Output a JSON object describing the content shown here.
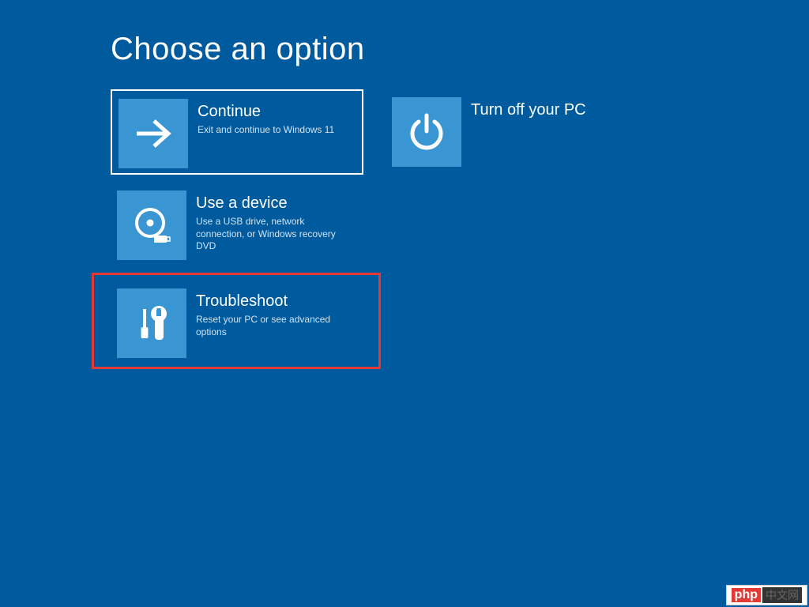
{
  "page": {
    "title": "Choose an option"
  },
  "tiles": {
    "continue": {
      "title": "Continue",
      "desc": "Exit and continue to Windows 11"
    },
    "turnoff": {
      "title": "Turn off your PC",
      "desc": ""
    },
    "usedevice": {
      "title": "Use a device",
      "desc": "Use a USB drive, network connection, or Windows recovery DVD"
    },
    "troubleshoot": {
      "title": "Troubleshoot",
      "desc": "Reset your PC or see advanced options"
    }
  },
  "watermark": {
    "label1": "php",
    "label2": "中文网"
  },
  "colors": {
    "background": "#005a9e",
    "tile_icon_bg": "#3a96d3",
    "highlight": "#e53935"
  }
}
